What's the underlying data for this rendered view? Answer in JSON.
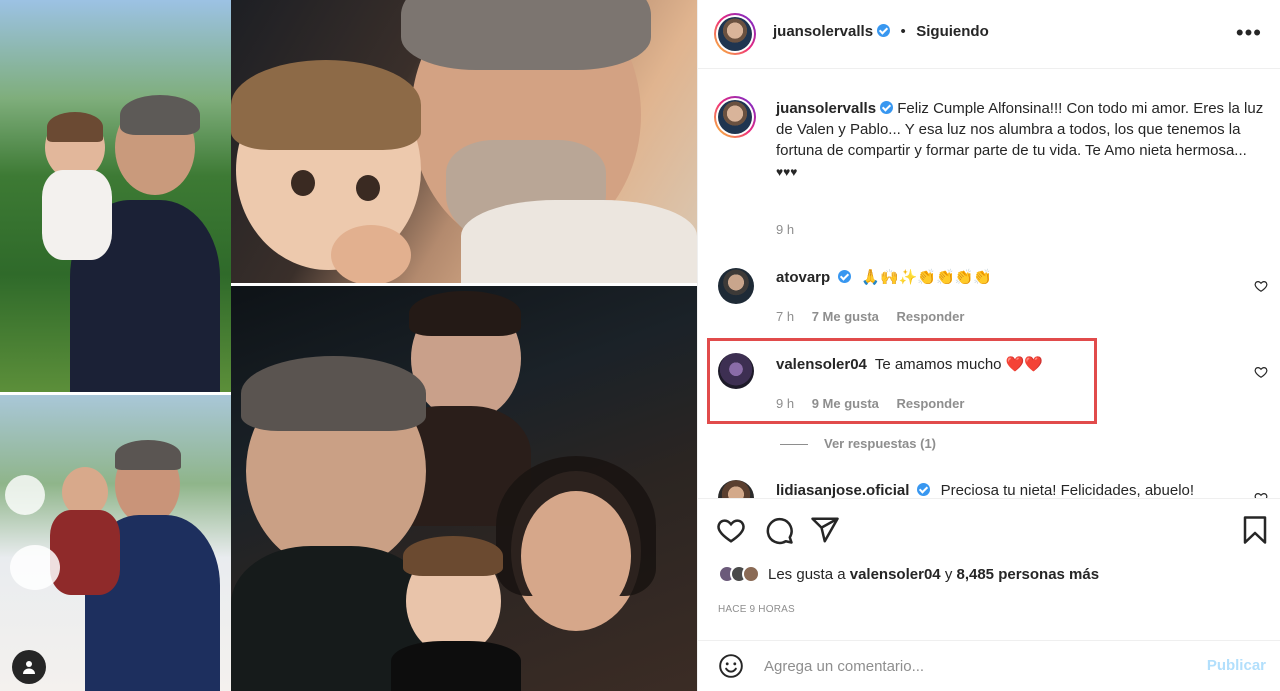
{
  "post": {
    "author": "juansolervalls",
    "follow_separator": "•",
    "follow_status": "Siguiendo",
    "more_icon": "more-horizontal-icon",
    "caption": "Feliz Cumple Alfonsina!!! Con todo mi amor. Eres la luz de Valen y Pablo... Y esa luz nos alumbra a todos, los que tenemos la fortuna de compartir y formar parte de tu vida. Te Amo nieta hermosa...",
    "caption_hearts": "♥♥♥",
    "caption_time": "9 h"
  },
  "comments": [
    {
      "username": "atovarp",
      "verified": true,
      "text": "🙏🙌✨👏👏👏👏",
      "time": "7 h",
      "likes": "7 Me gusta",
      "reply": "Responder"
    },
    {
      "username": "valensoler04",
      "verified": false,
      "text": "Te amamos mucho ❤️❤️",
      "time": "9 h",
      "likes": "9 Me gusta",
      "reply": "Responder",
      "view_replies": "Ver respuestas (1)"
    },
    {
      "username": "lidiasanjose.oficial",
      "verified": true,
      "text": "Preciosa tu nieta! Felicidades, abuelo!"
    }
  ],
  "actions": {
    "like_icon": "heart-icon",
    "comment_icon": "comment-icon",
    "share_icon": "share-icon",
    "save_icon": "bookmark-icon"
  },
  "likes": {
    "prefix": "Les gusta a",
    "user": "valensoler04",
    "joiner": "y",
    "others": "8,485 personas más"
  },
  "time_ago": "HACE 9 HORAS",
  "comment_box": {
    "placeholder": "Agrega un comentario...",
    "publish_label": "Publicar"
  },
  "colors": {
    "verified": "#3897f0",
    "highlight_border": "#e14b4b",
    "publish_disabled": "#b2dffc",
    "secondary_text": "#8e8e8e"
  }
}
